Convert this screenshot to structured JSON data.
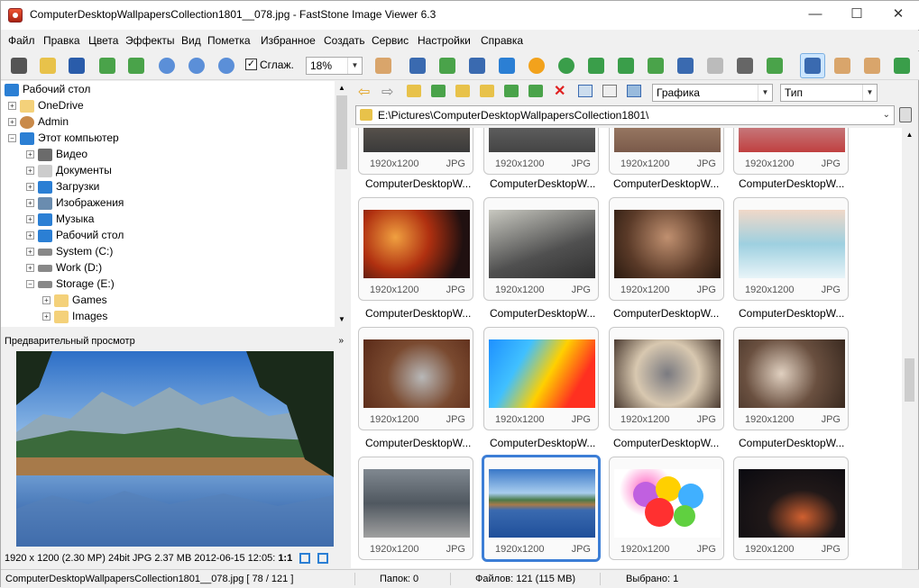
{
  "window": {
    "title": "ComputerDesktopWallpapersCollection1801__078.jpg  -  FastStone Image Viewer 6.3",
    "min": "—",
    "max": "☐",
    "close": "✕"
  },
  "menu": [
    "Файл",
    "Правка",
    "Цвета",
    "Эффекты",
    "Вид",
    "Пометка",
    "Избранное",
    "Создать",
    "Сервис",
    "Настройки",
    "Справка"
  ],
  "toolbar": {
    "smooth_label": "Сглаж.",
    "zoom": "18%"
  },
  "nav": {
    "filter": "Графика",
    "sort": "Тип",
    "path": "E:\\Pictures\\ComputerDesktopWallpapersCollection1801\\"
  },
  "tree": [
    {
      "label": "Рабочий стол"
    },
    {
      "label": "OneDrive"
    },
    {
      "label": "Admin"
    },
    {
      "label": "Этот компьютер"
    },
    {
      "label": "Видео"
    },
    {
      "label": "Документы"
    },
    {
      "label": "Загрузки"
    },
    {
      "label": "Изображения"
    },
    {
      "label": "Музыка"
    },
    {
      "label": "Рабочий стол"
    },
    {
      "label": "System (C:)"
    },
    {
      "label": "Work (D:)"
    },
    {
      "label": "Storage (E:)"
    },
    {
      "label": "Games"
    },
    {
      "label": "Images"
    }
  ],
  "preview": {
    "header": "Предварительный просмотр",
    "info": "1920 x 1200 (2.30 MP)  24bit  JPG  2.37 MB  2012-06-15 12:05:",
    "ratio": "1:1"
  },
  "thumb": {
    "res": "1920x1200",
    "fmt": "JPG",
    "caption": "ComputerDesktopW..."
  },
  "status": {
    "file": "ComputerDesktopWallpapersCollection1801__078.jpg [ 78 / 121 ]",
    "folders": "Папок: 0",
    "files": "Файлов: 121 (115 MB)",
    "selected": "Выбрано: 1"
  }
}
